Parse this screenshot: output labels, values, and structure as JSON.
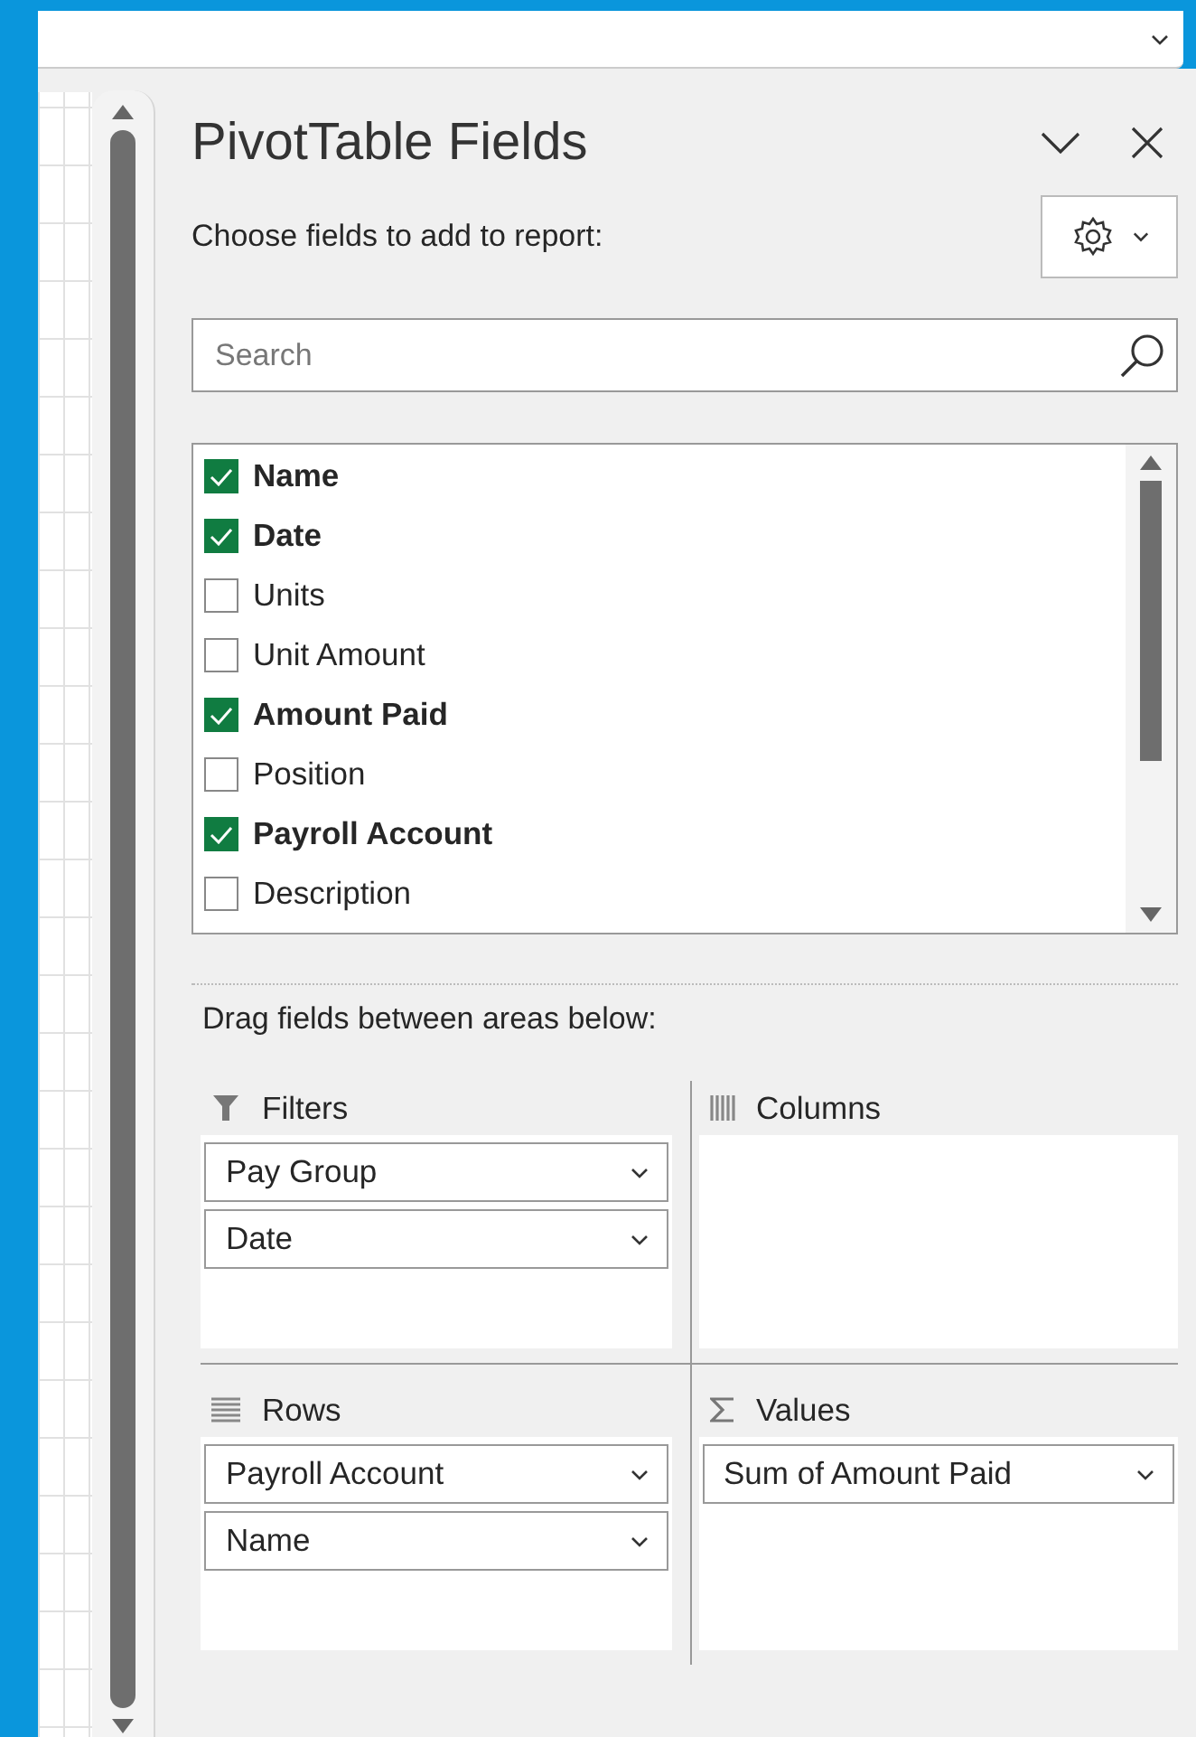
{
  "panel": {
    "title": "PivotTable Fields",
    "instruction": "Choose fields to add to report:"
  },
  "search": {
    "placeholder": "Search"
  },
  "fields": [
    {
      "label": "Name",
      "checked": true
    },
    {
      "label": "Date",
      "checked": true
    },
    {
      "label": "Units",
      "checked": false
    },
    {
      "label": "Unit Amount",
      "checked": false
    },
    {
      "label": "Amount Paid",
      "checked": true
    },
    {
      "label": "Position",
      "checked": false
    },
    {
      "label": "Payroll Account",
      "checked": true
    },
    {
      "label": "Description",
      "checked": false
    }
  ],
  "areas_heading": "Drag fields between areas below:",
  "areas": [
    {
      "kind": "filters",
      "title": "Filters",
      "items": [
        "Pay Group",
        "Date"
      ]
    },
    {
      "kind": "columns",
      "title": "Columns"
    },
    {
      "kind": "rows",
      "title": "Rows",
      "items": [
        "Payroll Account",
        "Name"
      ]
    },
    {
      "kind": "values",
      "title": "Values",
      "items": [
        "Sum of Amount Paid"
      ]
    }
  ]
}
